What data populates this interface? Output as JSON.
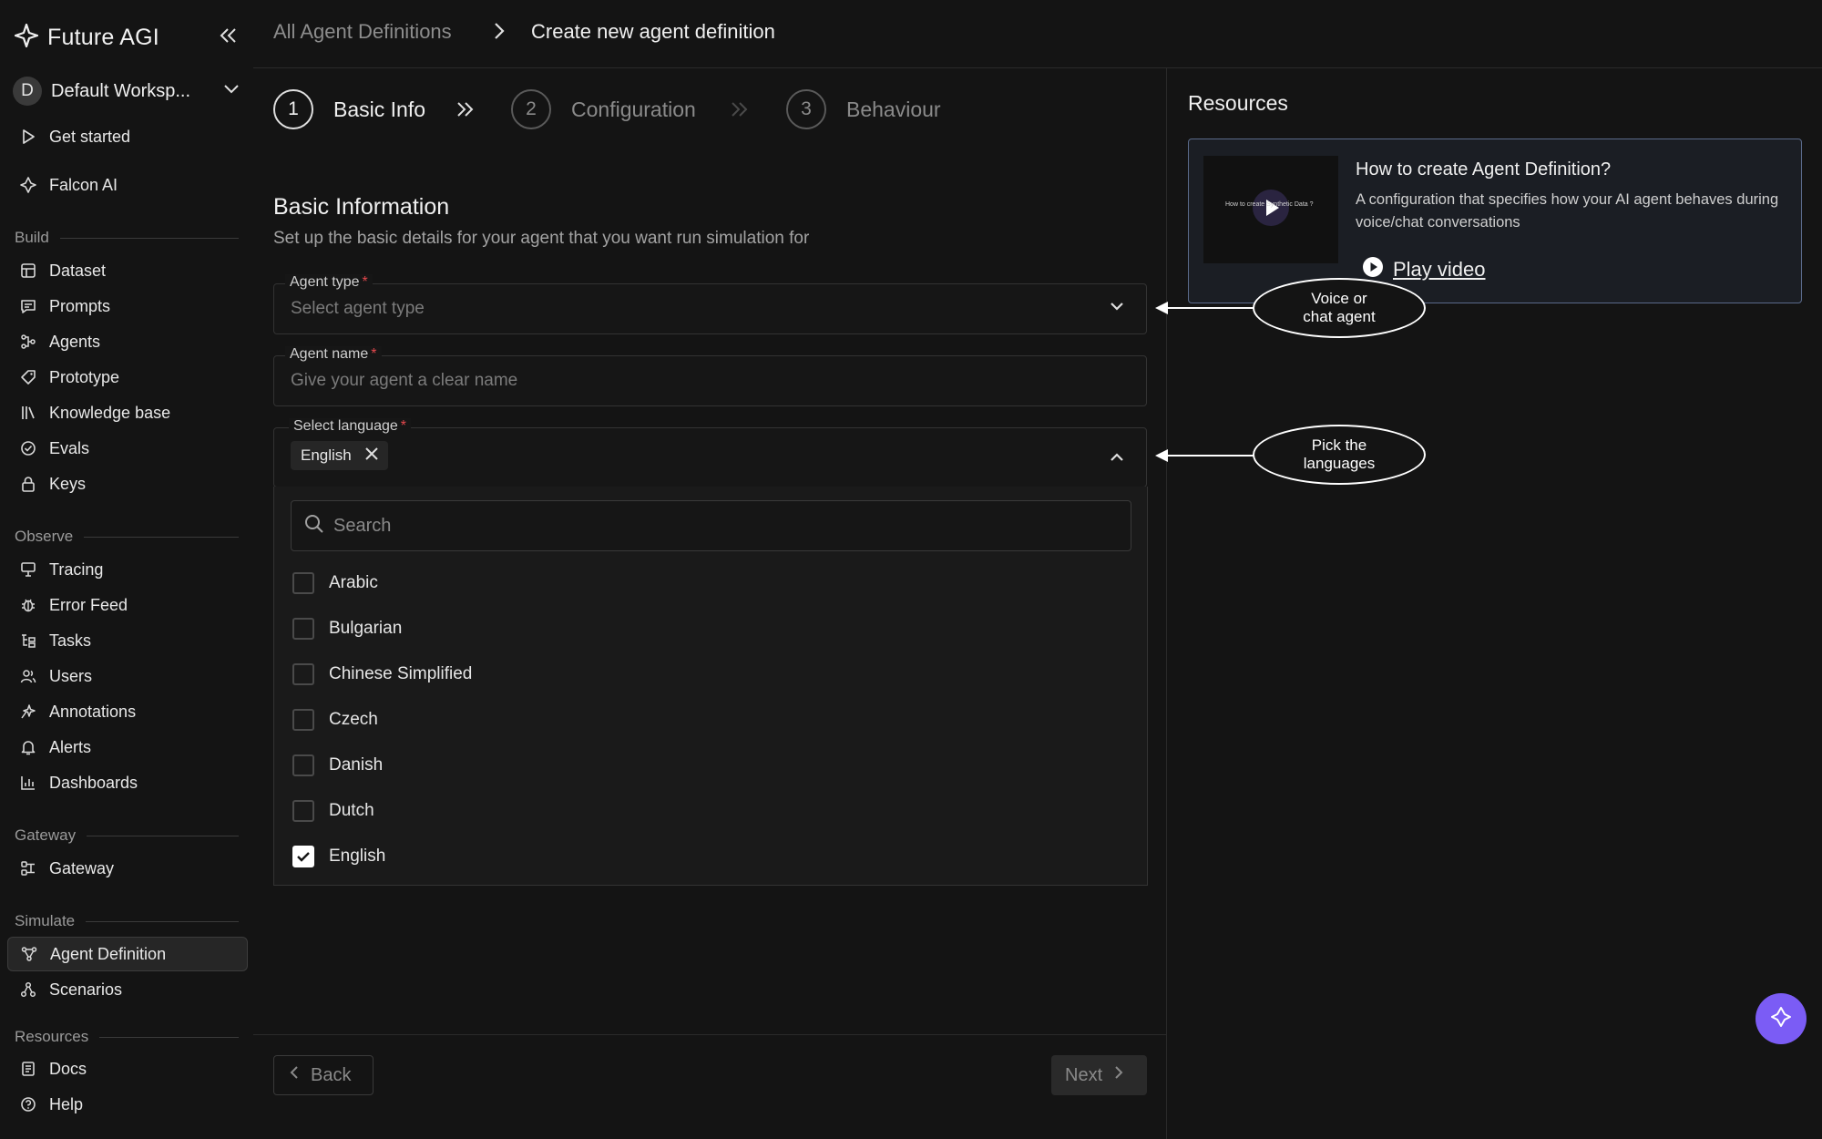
{
  "brand": {
    "name": "Future AGI"
  },
  "workspace": {
    "initial": "D",
    "name": "Default Worksp..."
  },
  "nav": {
    "get_started": "Get started",
    "falcon_ai": "Falcon AI",
    "sections": {
      "build": "Build",
      "observe": "Observe",
      "gateway": "Gateway",
      "simulate": "Simulate",
      "resources": "Resources"
    },
    "build_items": [
      "Dataset",
      "Prompts",
      "Agents",
      "Prototype",
      "Knowledge base",
      "Evals",
      "Keys"
    ],
    "observe_items": [
      "Tracing",
      "Error Feed",
      "Tasks",
      "Users",
      "Annotations",
      "Alerts",
      "Dashboards"
    ],
    "gateway_items": [
      "Gateway"
    ],
    "simulate_items": [
      "Agent Definition",
      "Scenarios"
    ],
    "resources_items": [
      "Docs",
      "Help"
    ]
  },
  "breadcrumb": {
    "parent": "All Agent Definitions",
    "current": "Create new agent definition"
  },
  "steps": [
    {
      "num": "1",
      "label": "Basic Info"
    },
    {
      "num": "2",
      "label": "Configuration"
    },
    {
      "num": "3",
      "label": "Behaviour"
    }
  ],
  "form": {
    "title": "Basic Information",
    "subtitle": "Set up the basic details for your agent that you want run simulation for",
    "agent_type": {
      "label": "Agent type",
      "required": "*",
      "placeholder": "Select agent type"
    },
    "agent_name": {
      "label": "Agent name",
      "required": "*",
      "placeholder": "Give your agent a clear name"
    },
    "language": {
      "label": "Select language",
      "required": "*",
      "selected_chip": "English"
    }
  },
  "language_dropdown": {
    "search_placeholder": "Search",
    "options": [
      {
        "label": "Arabic",
        "checked": false
      },
      {
        "label": "Bulgarian",
        "checked": false
      },
      {
        "label": "Chinese Simplified",
        "checked": false
      },
      {
        "label": "Czech",
        "checked": false
      },
      {
        "label": "Danish",
        "checked": false
      },
      {
        "label": "Dutch",
        "checked": false
      },
      {
        "label": "English",
        "checked": true
      }
    ]
  },
  "buttons": {
    "back": "Back",
    "next": "Next"
  },
  "resources": {
    "title": "Resources",
    "card_title": "How to create Agent Definition?",
    "card_desc": "A configuration that specifies how your AI agent behaves during voice/chat conversations",
    "play_label": "Play video",
    "thumb_text": "How to create Synthetic Data ?"
  },
  "callouts": {
    "agent_type": [
      "Voice or",
      "chat agent"
    ],
    "language": [
      "Pick the",
      "languages"
    ]
  },
  "colors": {
    "accent": "#7b5cf5",
    "required": "#e5484d",
    "card_border": "#5a6a8a"
  }
}
